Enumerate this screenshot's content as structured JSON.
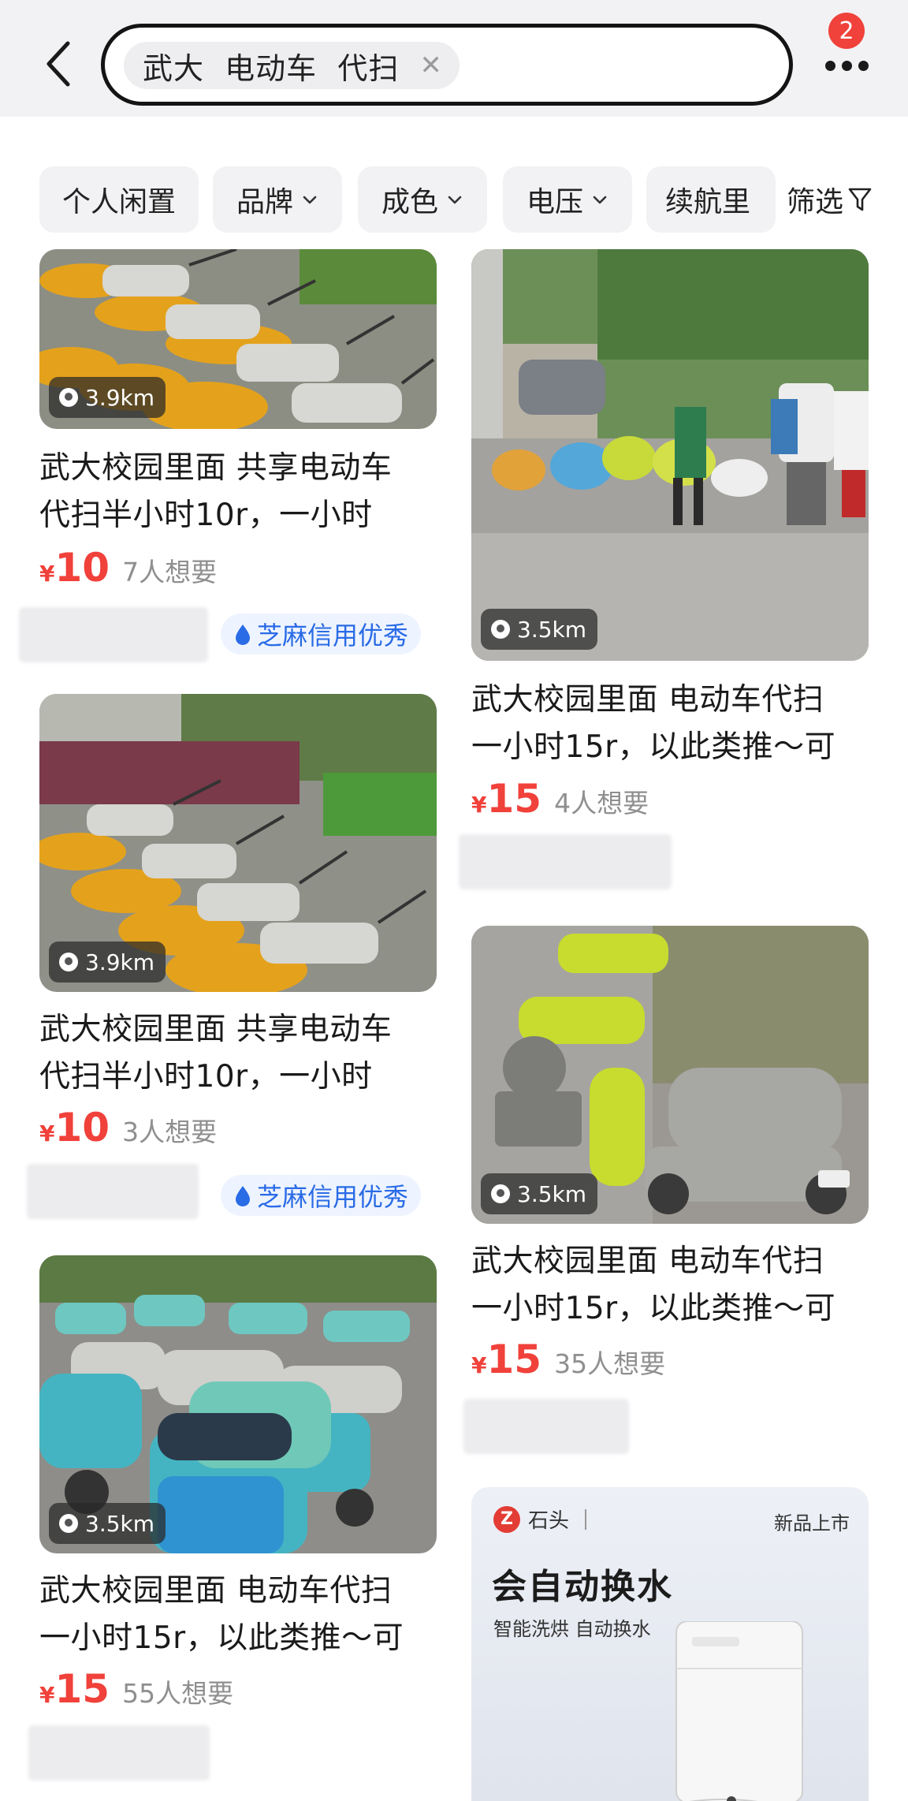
{
  "header": {
    "search_query": "武大  电动车  代扫",
    "notification_count": "2"
  },
  "filters": [
    {
      "label": "个人闲置"
    },
    {
      "label": "品牌"
    },
    {
      "label": "成色"
    },
    {
      "label": "电压"
    },
    {
      "label": "续航里"
    }
  ],
  "screen_label": "筛选",
  "colors": {
    "accent": "#f0413a",
    "credit_blue": "#2a6be6"
  },
  "listings": [
    {
      "distance": "3.9km",
      "title": "武大校园里面 共享电动车\n代扫半小时10r，一小时",
      "currency": "¥",
      "price": "10",
      "want": "7人想要",
      "credit": "芝麻信用优秀"
    },
    {
      "distance": "3.5km",
      "title": "武大校园里面 电动车代扫\n一小时15r，以此类推～可",
      "currency": "¥",
      "price": "15",
      "want": "4人想要"
    },
    {
      "distance": "3.9km",
      "title": "武大校园里面 共享电动车\n代扫半小时10r，一小时",
      "currency": "¥",
      "price": "10",
      "want": "3人想要",
      "credit": "芝麻信用优秀"
    },
    {
      "distance": "3.5km",
      "title": "武大校园里面 电动车代扫\n一小时15r，以此类推～可",
      "currency": "¥",
      "price": "15",
      "want": "35人想要"
    },
    {
      "distance": "3.5km",
      "title": "武大校园里面 电动车代扫\n一小时15r，以此类推～可",
      "currency": "¥",
      "price": "15",
      "want": "55人想要"
    }
  ],
  "ad": {
    "brand": "石头",
    "tag": "新品上市",
    "headline": "会自动换水",
    "subline": "智能洗烘 自动换水"
  }
}
